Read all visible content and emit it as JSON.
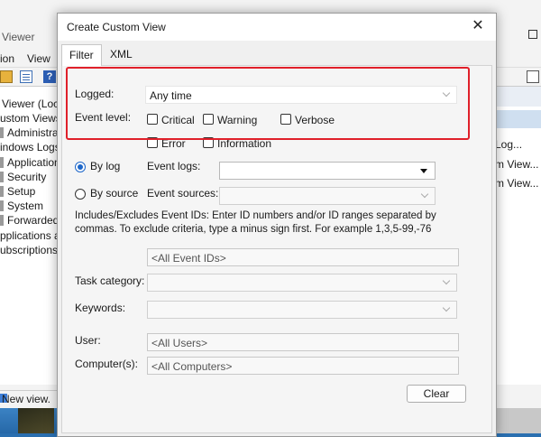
{
  "background_window": {
    "title": "Viewer",
    "menu": [
      "ion",
      "View"
    ],
    "tree": [
      "Viewer (Local)",
      "ustom Views",
      "Administrati",
      "indows Logs",
      "Application",
      "Security",
      "Setup",
      "System",
      "Forwarded E",
      "pplications an",
      "ubscriptions"
    ],
    "actions": [
      "Log...",
      "m View...",
      "m View..."
    ],
    "status": "New view."
  },
  "dialog": {
    "title": "Create Custom View",
    "close_label": "✕",
    "tabs": [
      "Filter",
      "XML"
    ],
    "logged_label": "Logged:",
    "logged_value": "Any time",
    "event_level_label": "Event level:",
    "levels": {
      "critical": "Critical",
      "warning": "Warning",
      "verbose": "Verbose",
      "error": "Error",
      "information": "Information"
    },
    "by_log_label": "By log",
    "by_source_label": "By source",
    "event_logs_label": "Event logs:",
    "event_sources_label": "Event sources:",
    "event_ids_help": "Includes/Excludes Event IDs: Enter ID numbers and/or ID ranges separated by commas. To exclude criteria, type a minus sign first. For example 1,3,5-99,-76",
    "event_ids_placeholder": "<All Event IDs>",
    "task_category_label": "Task category:",
    "keywords_label": "Keywords:",
    "user_label": "User:",
    "user_placeholder": "<All Users>",
    "computers_label": "Computer(s):",
    "computers_placeholder": "<All Computers>",
    "clear_label": "Clear"
  },
  "colors": {
    "highlight": "#e0202a",
    "accent": "#1c66c9"
  }
}
